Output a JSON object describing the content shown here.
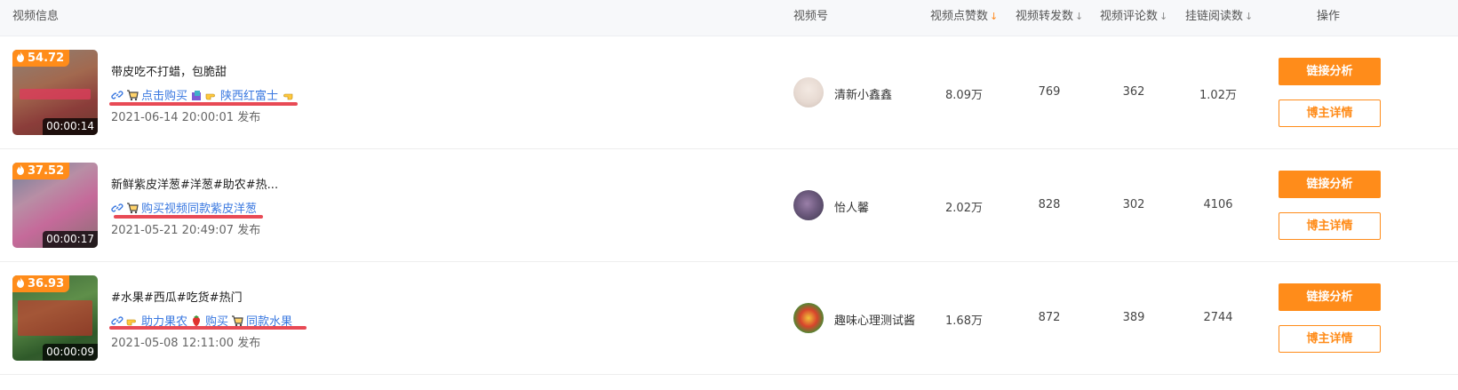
{
  "header": {
    "video_info": "视频信息",
    "account": "视频号",
    "likes": "视频点赞数",
    "shares": "视频转发数",
    "comments": "视频评论数",
    "link_reads": "挂链阅读数",
    "actions": "操作",
    "sort_arrow": "↓"
  },
  "colors": {
    "accent": "#ff8c1a",
    "link": "#3a78e0",
    "underline": "#e84a55"
  },
  "rows": [
    {
      "heat": "54.72",
      "duration": "00:00:14",
      "title": "带皮吃不打蜡，包脆甜",
      "link_parts": [
        "点击购买",
        "陕西红富士"
      ],
      "publish": "2021-06-14 20:00:01 发布",
      "account": "清新小鑫鑫",
      "likes": "8.09万",
      "shares": "769",
      "comments": "362",
      "link_reads": "1.02万",
      "btn_analysis": "链接分析",
      "btn_detail": "博主详情"
    },
    {
      "heat": "37.52",
      "duration": "00:00:17",
      "title": "新鲜紫皮洋葱#洋葱#助农#热...",
      "link_parts": [
        "购买视频同款紫皮洋葱"
      ],
      "publish": "2021-05-21 20:49:07 发布",
      "account": "怡人馨",
      "likes": "2.02万",
      "shares": "828",
      "comments": "302",
      "link_reads": "4106",
      "btn_analysis": "链接分析",
      "btn_detail": "博主详情"
    },
    {
      "heat": "36.93",
      "duration": "00:00:09",
      "title": "#水果#西瓜#吃货#热门",
      "link_parts": [
        "助力果农",
        "购买",
        "同款水果"
      ],
      "publish": "2021-05-08 12:11:00 发布",
      "account": "趣味心理测试酱",
      "likes": "1.68万",
      "shares": "872",
      "comments": "389",
      "link_reads": "2744",
      "btn_analysis": "链接分析",
      "btn_detail": "博主详情"
    }
  ]
}
